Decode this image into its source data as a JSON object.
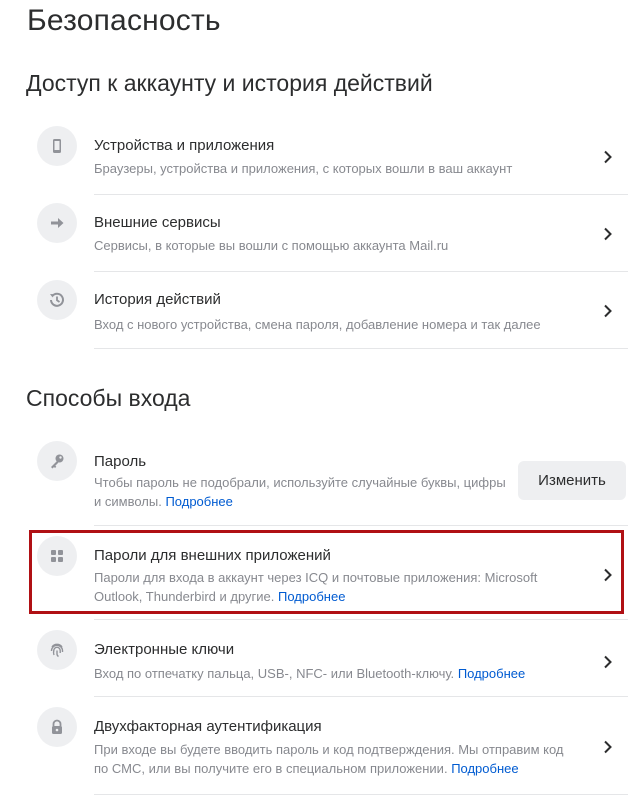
{
  "page_title": "Безопасность",
  "sections": [
    {
      "title": "Доступ к аккаунту и история действий",
      "items": [
        {
          "title": "Устройства и приложения",
          "desc": "Браузеры, устройства и приложения, с которых вошли в ваш аккаунт",
          "icon": "phone-icon"
        },
        {
          "title": "Внешние сервисы",
          "desc": "Сервисы, в которые вы вошли с помощью аккаунта Mail.ru",
          "icon": "arrow-right-icon"
        },
        {
          "title": "История действий",
          "desc": "Вход с нового устройства, смена пароля, добавление номера и так далее",
          "icon": "history-icon"
        }
      ]
    },
    {
      "title": "Способы входа",
      "items": [
        {
          "title": "Пароль",
          "desc_line1": "Чтобы пароль не подобрали, используйте случайные буквы, цифры",
          "desc_line2": "и символы.",
          "more": "Подробнее",
          "button": "Изменить",
          "icon": "key-icon"
        },
        {
          "title": "Пароли для внешних приложений",
          "desc_line1": "Пароли для входа в аккаунт через ICQ и почтовые приложения: Microsoft",
          "desc_line2": "Outlook, Thunderbird и другие.",
          "more": "Подробнее",
          "icon": "apps-grid-icon",
          "highlighted": true
        },
        {
          "title": "Электронные ключи",
          "desc_line1": "Вход по отпечатку пальца, USB-, NFC- или Bluetooth-ключу.",
          "more": "Подробнее",
          "icon": "fingerprint-icon"
        },
        {
          "title": "Двухфакторная аутентификация",
          "desc_line1": "При входе вы будете вводить пароль и код подтверждения. Мы отправим код",
          "desc_line2": "по СМС, или вы получите его в специальном приложении.",
          "more": "Подробнее",
          "icon": "lock-icon"
        }
      ]
    }
  ],
  "colors": {
    "link": "#005bd1",
    "highlight_border": "#b01014",
    "icon_bg": "#eeeff1"
  }
}
